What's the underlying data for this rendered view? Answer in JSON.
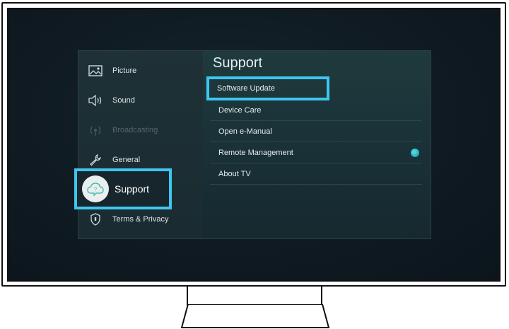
{
  "menu": {
    "categories": [
      {
        "label": "Picture",
        "icon": "picture-icon",
        "enabled": true
      },
      {
        "label": "Sound",
        "icon": "speaker-icon",
        "enabled": true
      },
      {
        "label": "Broadcasting",
        "icon": "broadcast-icon",
        "enabled": false
      },
      {
        "label": "General",
        "icon": "wrench-icon",
        "enabled": true
      },
      {
        "label": "Support",
        "icon": "cloud-question-icon",
        "enabled": true,
        "selected": true
      },
      {
        "label": "Terms & Privacy",
        "icon": "shield-icon",
        "enabled": true
      }
    ]
  },
  "panel": {
    "title": "Support",
    "items": [
      {
        "label": "Software Update",
        "highlighted": true
      },
      {
        "label": "Device Care"
      },
      {
        "label": "Open e-Manual"
      },
      {
        "label": "Remote Management",
        "indicator": "teal-dot"
      },
      {
        "label": "About TV"
      }
    ]
  },
  "colors": {
    "highlight": "#3fc6f0",
    "indicator": "#2ab3bd",
    "panel_bg": "#172a30"
  }
}
